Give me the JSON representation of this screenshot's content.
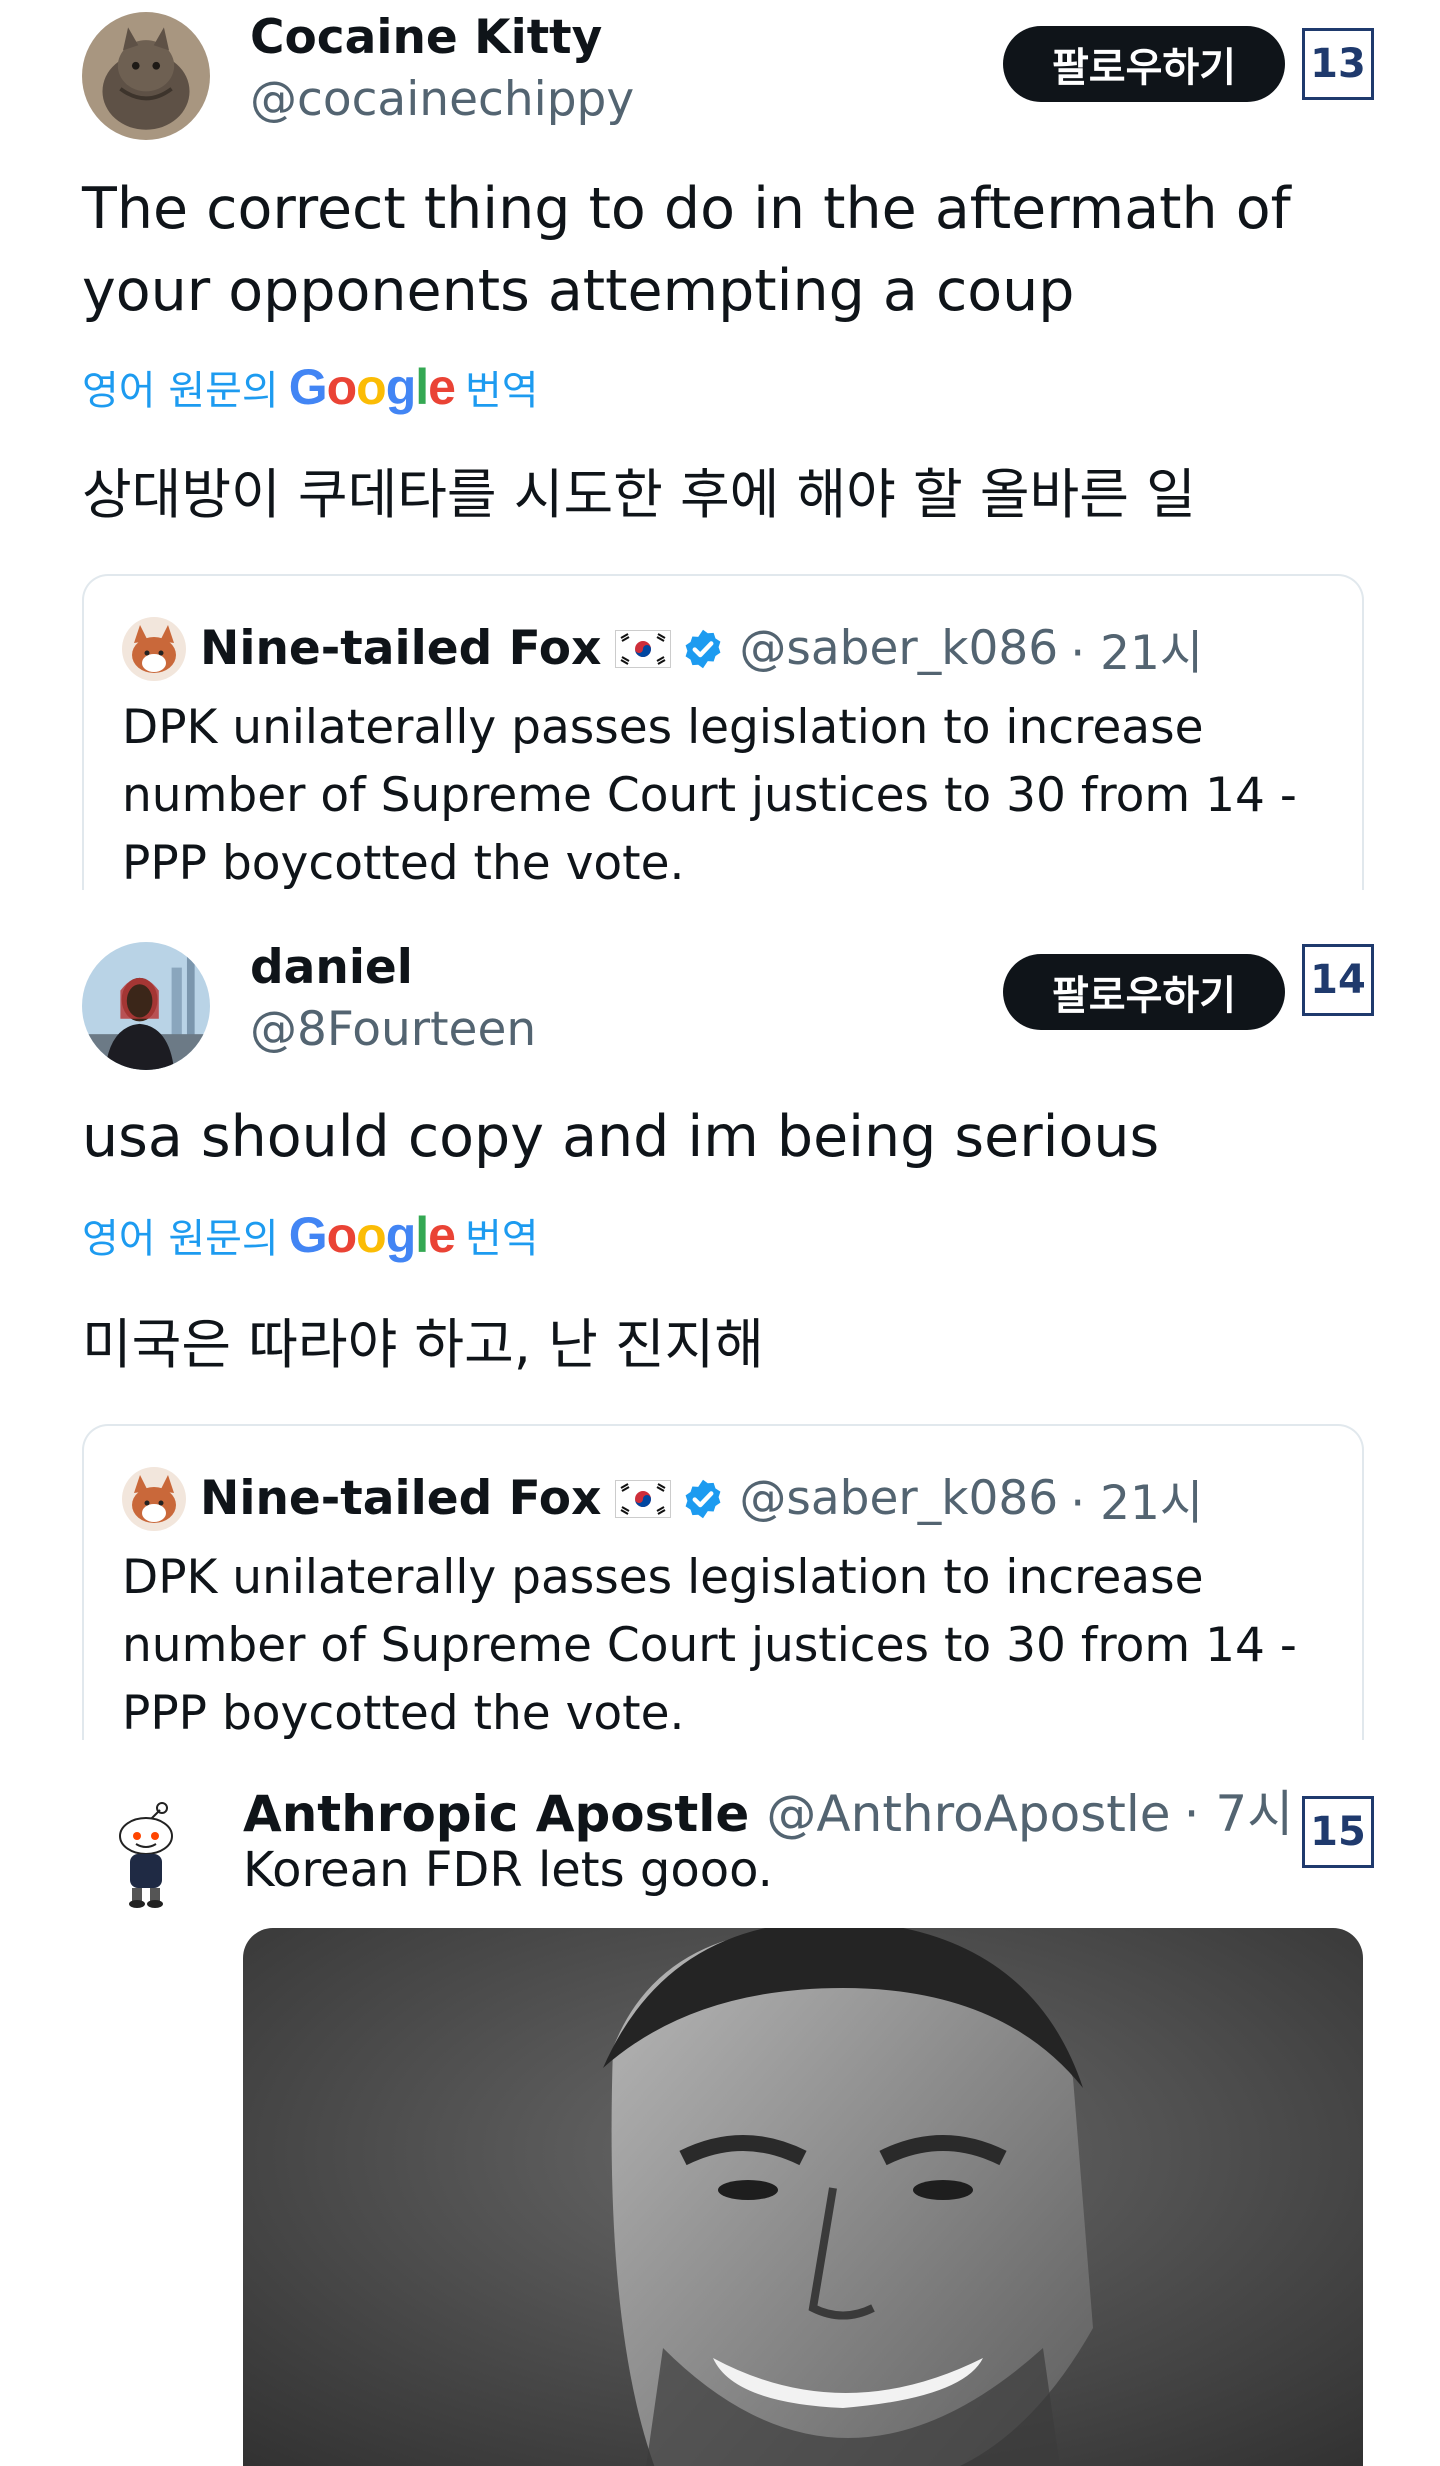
{
  "tweets": [
    {
      "name": "Cocaine Kitty",
      "handle": "@cocainechippy",
      "follow_label": "팔로우하기",
      "index_badge": "13",
      "text": "The correct thing to do in the aftermath of your opponents attempting a coup",
      "translate_prefix": "영어 원문의",
      "translate_brand": "Google",
      "translate_suffix": "번역",
      "translation": "상대방이 쿠데타를 시도한 후에 해야 할 올바른 일",
      "quote": {
        "name": "Nine-tailed Fox",
        "handle": "@saber_k086",
        "time": "· 21시",
        "text": "DPK unilaterally passes legislation to increase number of Supreme Court justices to 30 from 14 - PPP boycotted the vote."
      }
    },
    {
      "name": "daniel",
      "handle": "@8Fourteen",
      "follow_label": "팔로우하기",
      "index_badge": "14",
      "text": "usa should copy and im being serious",
      "translate_prefix": "영어 원문의",
      "translate_brand": "Google",
      "translate_suffix": "번역",
      "translation": "미국은 따라야 하고, 난 진지해",
      "quote": {
        "name": "Nine-tailed Fox",
        "handle": "@saber_k086",
        "time": "· 21시",
        "text": "DPK unilaterally passes legislation to increase number of Supreme Court justices to 30 from 14 - PPP boycotted the vote."
      }
    }
  ],
  "reply": {
    "name": "Anthropic Apostle",
    "handle": "@AnthroApostle",
    "time": "· 7시",
    "text": "Korean FDR lets gooo.",
    "index_badge": "15"
  },
  "colors": {
    "link_blue": "#1d9bf0",
    "badge_border": "#1f3a6d",
    "muted_text": "#536471",
    "follow_button": "#0f1419"
  }
}
